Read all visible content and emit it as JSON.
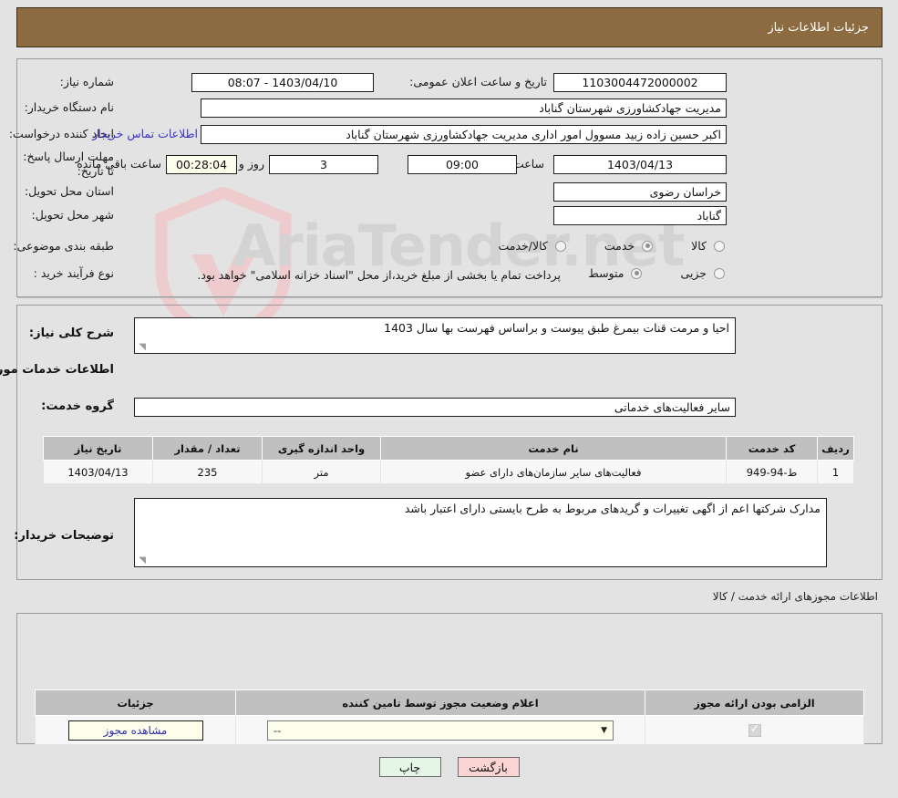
{
  "header": {
    "title": "جزئیات اطلاعات نیاز"
  },
  "top": {
    "need_number_label": "شماره نیاز:",
    "need_number_value": "1103004472000002",
    "announce_datetime_label": "تاریخ و ساعت اعلان عمومی:",
    "announce_datetime_value": "1403/04/10 - 08:07",
    "buyer_org_label": "نام دستگاه خریدار:",
    "buyer_org_value": "مدیریت جهادکشاورزی شهرستان گناباد",
    "creator_label": "ایجاد کننده درخواست:",
    "creator_value": "اکبر حسین زاده زبید مسوول امور اداری مدیریت جهادکشاورزی شهرستان گناباد",
    "contact_link": "اطلاعات تماس خریدار",
    "deadline_label": "مهلت ارسال پاسخ: تا تاریخ:",
    "deadline_date": "1403/04/13",
    "hour_label": "ساعت",
    "deadline_time": "09:00",
    "days_value": "3",
    "days_label": "روز و",
    "countdown_value": "00:28:04",
    "countdown_label": "ساعت باقی مانده",
    "province_label": "استان محل تحویل:",
    "province_value": "خراسان رضوی",
    "city_label": "شهر محل تحویل:",
    "city_value": "گناباد",
    "classification_label": "طبقه بندی موضوعی:",
    "classification_options": [
      {
        "label": "کالا",
        "selected": false
      },
      {
        "label": "خدمت",
        "selected": true
      },
      {
        "label": "کالا/خدمت",
        "selected": false
      }
    ],
    "process_label": "نوع فرآیند خرید :",
    "process_options": [
      {
        "label": "جزیی",
        "selected": false
      },
      {
        "label": "متوسط",
        "selected": true
      }
    ],
    "payment_note": "پرداخت تمام یا بخشی از مبلغ خرید،از محل \"اسناد خزانه اسلامی\" خواهد بود."
  },
  "middle": {
    "general_desc_label": "شرح کلی نیاز:",
    "general_desc_value": "احیا و مرمت قنات بیمرغ طبق پیوست و براساس فهرست بها سال 1403",
    "services_heading": "اطلاعات خدمات مورد نیاز",
    "service_group_label": "گروه خدمت:",
    "service_group_value": "سایر فعالیت‌های خدماتی",
    "table": {
      "columns": [
        "ردیف",
        "کد خدمت",
        "نام خدمت",
        "واحد اندازه گیری",
        "تعداد / مقدار",
        "تاریخ نیاز"
      ],
      "rows": [
        {
          "row": "1",
          "code": "ط-94-949",
          "name": "فعالیت‌های سایر سازمان‌های دارای عضو",
          "unit": "متر",
          "qty": "235",
          "date": "1403/04/13"
        }
      ]
    },
    "buyer_notes_label": "توضیحات خریدار:",
    "buyer_notes_value": "مدارک شرکتها اعم از اگهی تغییرات و گریدهای مربوط به طرح بایستی دارای اعتبار باشد"
  },
  "permits": {
    "section_label": "اطلاعات مجوزهای ارائه خدمت / کالا",
    "columns": [
      "الزامی بودن ارائه مجوز",
      "اعلام وضعیت مجوز توسط تامین کننده",
      "جزئیات"
    ],
    "rows": [
      {
        "required": true,
        "status_value": "--",
        "detail_label": "مشاهده مجوز"
      }
    ]
  },
  "footer": {
    "print_label": "چاپ",
    "back_label": "بازگشت"
  },
  "watermark": {
    "text": "AriaTender.net"
  },
  "colors": {
    "header_bg": "#8b6b3f",
    "page_bg": "#e3e3e3",
    "link": "#3b32c8",
    "table_header": "#c0c0c0",
    "print_btn": "#e6f6e6",
    "back_btn": "#fbd4d4"
  }
}
